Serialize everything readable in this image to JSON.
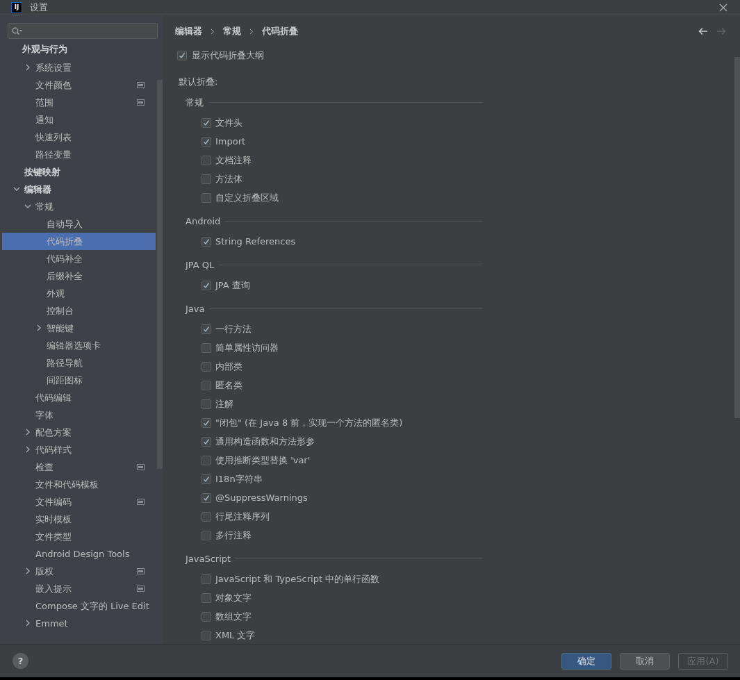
{
  "window": {
    "logo": "IJ",
    "title": "设置"
  },
  "sidebar": {
    "header": "外观与行为",
    "items": [
      {
        "label": "系统设置",
        "expanded": false,
        "badge": false,
        "selected": false
      },
      {
        "label": "文件颜色",
        "badge": true,
        "selected": false
      },
      {
        "label": "范围",
        "badge": true,
        "selected": false
      },
      {
        "label": "通知",
        "badge": false,
        "selected": false
      },
      {
        "label": "快速列表",
        "badge": false,
        "selected": false
      },
      {
        "label": "路径变量",
        "badge": false,
        "selected": false
      },
      {
        "label": "按键映射",
        "top": true,
        "badge": false,
        "selected": false
      },
      {
        "label": "编辑器",
        "top": true,
        "expanded": true,
        "badge": false,
        "selected": false,
        "children": [
          {
            "label": "常规",
            "expanded": true,
            "badge": false,
            "selected": false,
            "children": [
              {
                "label": "自动导入",
                "badge": false,
                "selected": false
              },
              {
                "label": "代码折叠",
                "badge": false,
                "selected": true
              },
              {
                "label": "代码补全",
                "badge": false,
                "selected": false
              },
              {
                "label": "后缀补全",
                "badge": false,
                "selected": false
              },
              {
                "label": "外观",
                "badge": false,
                "selected": false
              },
              {
                "label": "控制台",
                "badge": false,
                "selected": false
              },
              {
                "label": "智能键",
                "expanded": false,
                "badge": false,
                "selected": false
              },
              {
                "label": "编辑器选项卡",
                "badge": false,
                "selected": false
              },
              {
                "label": "路径导航",
                "badge": false,
                "selected": false
              },
              {
                "label": "间距图标",
                "badge": false,
                "selected": false
              }
            ]
          },
          {
            "label": "代码编辑",
            "badge": false,
            "selected": false
          },
          {
            "label": "字体",
            "badge": false,
            "selected": false
          },
          {
            "label": "配色方案",
            "expanded": false,
            "badge": false,
            "selected": false
          },
          {
            "label": "代码样式",
            "expanded": false,
            "badge": false,
            "selected": false
          },
          {
            "label": "检查",
            "badge": true,
            "selected": false
          },
          {
            "label": "文件和代码模板",
            "badge": false,
            "selected": false
          },
          {
            "label": "文件编码",
            "badge": true,
            "selected": false
          },
          {
            "label": "实时模板",
            "badge": false,
            "selected": false
          },
          {
            "label": "文件类型",
            "badge": false,
            "selected": false
          },
          {
            "label": "Android Design Tools",
            "badge": false,
            "selected": false
          },
          {
            "label": "版权",
            "expanded": false,
            "badge": true,
            "selected": false
          },
          {
            "label": "嵌入提示",
            "badge": true,
            "selected": false
          },
          {
            "label": "Compose 文字的 Live Edit",
            "badge": false,
            "selected": false
          },
          {
            "label": "Emmet",
            "expanded": false,
            "badge": false,
            "selected": false
          }
        ]
      }
    ]
  },
  "breadcrumb": [
    "编辑器",
    "常规",
    "代码折叠"
  ],
  "nav": {
    "back_disabled": false,
    "forward_disabled": true
  },
  "outline": {
    "label": "显示代码折叠大纲",
    "checked": true
  },
  "default_label": "默认折叠:",
  "sections": [
    {
      "title": "常规",
      "items": [
        {
          "label": "文件头",
          "checked": true
        },
        {
          "label": "Import",
          "checked": true
        },
        {
          "label": "文档注释",
          "checked": false
        },
        {
          "label": "方法体",
          "checked": false
        },
        {
          "label": "自定义折叠区域",
          "checked": false
        }
      ]
    },
    {
      "title": "Android",
      "items": [
        {
          "label": "String References",
          "checked": true
        }
      ]
    },
    {
      "title": "JPA QL",
      "items": [
        {
          "label": "JPA 查询",
          "checked": true
        }
      ]
    },
    {
      "title": "Java",
      "items": [
        {
          "label": "一行方法",
          "checked": true
        },
        {
          "label": "简单属性访问器",
          "checked": false
        },
        {
          "label": "内部类",
          "checked": false
        },
        {
          "label": "匿名类",
          "checked": false
        },
        {
          "label": "注解",
          "checked": false
        },
        {
          "label": "\"闭包\" (在 Java 8 前，实现一个方法的匿名类)",
          "checked": true
        },
        {
          "label": "通用构造函数和方法形参",
          "checked": true
        },
        {
          "label": "使用推断类型替换 'var'",
          "checked": false
        },
        {
          "label": "I18n字符串",
          "checked": true
        },
        {
          "label": "@SuppressWarnings",
          "checked": true
        },
        {
          "label": "行尾注释序列",
          "checked": false
        },
        {
          "label": "多行注释",
          "checked": false
        }
      ]
    },
    {
      "title": "JavaScript",
      "items": [
        {
          "label": "JavaScript 和 TypeScript 中的单行函数",
          "checked": false
        },
        {
          "label": "对象文字",
          "checked": false
        },
        {
          "label": "数组文字",
          "checked": false
        },
        {
          "label": "XML 文字",
          "checked": false
        }
      ]
    }
  ],
  "help": "?",
  "buttons": [
    {
      "label": "确定",
      "kind": "default",
      "disabled": false
    },
    {
      "label": "取消",
      "kind": "normal",
      "disabled": false
    },
    {
      "label": "应用(A)",
      "kind": "normal",
      "disabled": true
    }
  ]
}
